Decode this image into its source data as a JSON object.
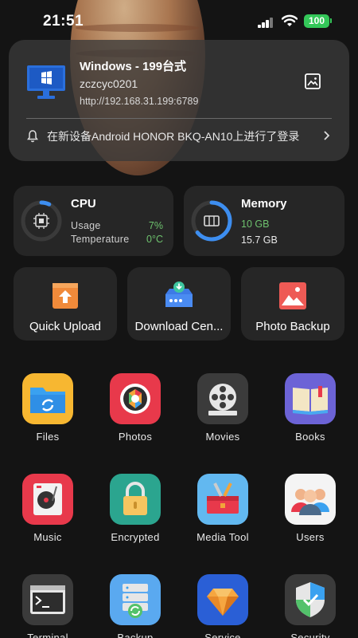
{
  "status_bar": {
    "time": "21:51",
    "battery": "100"
  },
  "device": {
    "name": "Windows - 199台式",
    "user": "zczcyc0201",
    "url": "http://192.168.31.199:6789",
    "notice": "在新设备Android HONOR BKQ-AN10上进行了登录"
  },
  "cpu": {
    "title": "CPU",
    "usage_label": "Usage",
    "usage_value": "7%",
    "usage_fraction": 0.07,
    "temp_label": "Temperature",
    "temp_value": "0°C"
  },
  "memory": {
    "title": "Memory",
    "used": "10 GB",
    "total": "15.7 GB",
    "used_fraction": 0.64
  },
  "quick_actions": [
    {
      "label": "Quick Upload",
      "icon": "upload-icon"
    },
    {
      "label": "Download Cen...",
      "icon": "download-center-icon"
    },
    {
      "label": "Photo Backup",
      "icon": "photo-backup-icon"
    }
  ],
  "apps": [
    {
      "label": "Files",
      "icon": "files-icon"
    },
    {
      "label": "Photos",
      "icon": "photos-icon"
    },
    {
      "label": "Movies",
      "icon": "movies-icon"
    },
    {
      "label": "Books",
      "icon": "books-icon"
    },
    {
      "label": "Music",
      "icon": "music-icon"
    },
    {
      "label": "Encrypted",
      "icon": "encrypted-icon"
    },
    {
      "label": "Media Tool",
      "icon": "media-tool-icon"
    },
    {
      "label": "Users",
      "icon": "users-icon"
    },
    {
      "label": "Terminal",
      "icon": "terminal-icon"
    },
    {
      "label": "Backup",
      "icon": "backup-icon"
    },
    {
      "label": "Service",
      "icon": "service-icon"
    },
    {
      "label": "Security",
      "icon": "security-icon"
    }
  ],
  "colors": {
    "accent_blue": "#3d8ef0",
    "value_green": "#6ec26e",
    "battery_green": "#34c759"
  }
}
